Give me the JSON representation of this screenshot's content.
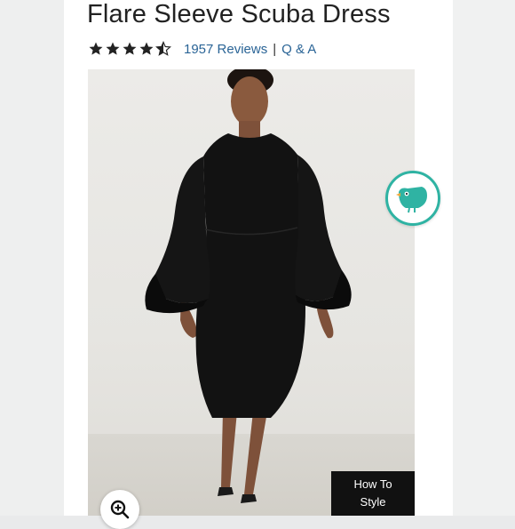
{
  "product": {
    "title": "Flare Sleeve Scuba Dress",
    "rating_stars": 4.5,
    "reviews_label": "1957 Reviews",
    "separator": "|",
    "qa_label": "Q & A"
  },
  "media": {
    "how_to_style_line1": "How To",
    "how_to_style_line2": "Style",
    "zoom_icon": "zoom-in-icon",
    "chat_icon": "chat-bird-icon"
  },
  "colors": {
    "accent": "#2fb3a3",
    "link": "#2a6496",
    "button_dark": "#111111"
  }
}
